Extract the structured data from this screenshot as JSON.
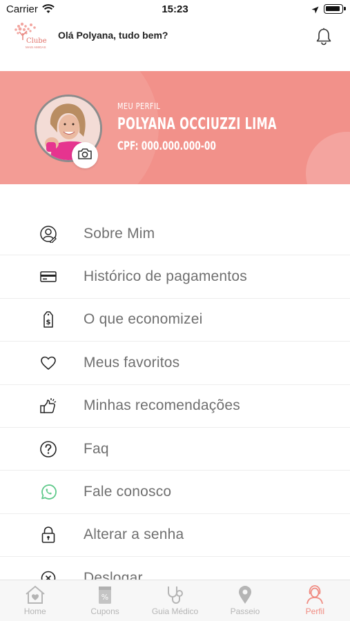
{
  "status_bar": {
    "carrier": "Carrier",
    "time": "15:23"
  },
  "header": {
    "logo_text_1": "Clube",
    "logo_text_2": "MAIS AMIGAS",
    "greeting": "Olá Polyana, tudo bem?",
    "icons": {
      "notification": "bell-icon"
    }
  },
  "profile": {
    "section_label": "MEU PERFIL",
    "name": "POLYANA OCCIUZZI LIMA",
    "cpf": "CPF: 000.000.000-00",
    "banner_color": "#f2918a"
  },
  "menu": {
    "items": [
      {
        "label": "Sobre Mim",
        "icon": "user-edit-icon"
      },
      {
        "label": "Histórico de pagamentos",
        "icon": "credit-card-icon"
      },
      {
        "label": "O que economizei",
        "icon": "money-tag-icon"
      },
      {
        "label": "Meus favoritos",
        "icon": "heart-icon"
      },
      {
        "label": "Minhas recomendações",
        "icon": "thumbs-up-icon"
      },
      {
        "label": "Faq",
        "icon": "question-icon"
      },
      {
        "label": "Fale conosco",
        "icon": "whatsapp-icon"
      },
      {
        "label": "Alterar a senha",
        "icon": "lock-icon"
      },
      {
        "label": "Deslogar",
        "icon": "logout-icon"
      }
    ]
  },
  "tab_bar": {
    "tabs": [
      {
        "label": "Home",
        "icon": "home-icon",
        "active": false
      },
      {
        "label": "Cupons",
        "icon": "coupon-icon",
        "active": false
      },
      {
        "label": "Guia Médico",
        "icon": "stethoscope-icon",
        "active": false
      },
      {
        "label": "Passeio",
        "icon": "map-pin-icon",
        "active": false
      },
      {
        "label": "Perfil",
        "icon": "profile-icon",
        "active": true
      }
    ]
  },
  "colors": {
    "accent": "#f08a80",
    "menu_text": "#6f6f6f",
    "whatsapp": "#5fc98a",
    "tab_inactive": "#b5b5b5"
  }
}
